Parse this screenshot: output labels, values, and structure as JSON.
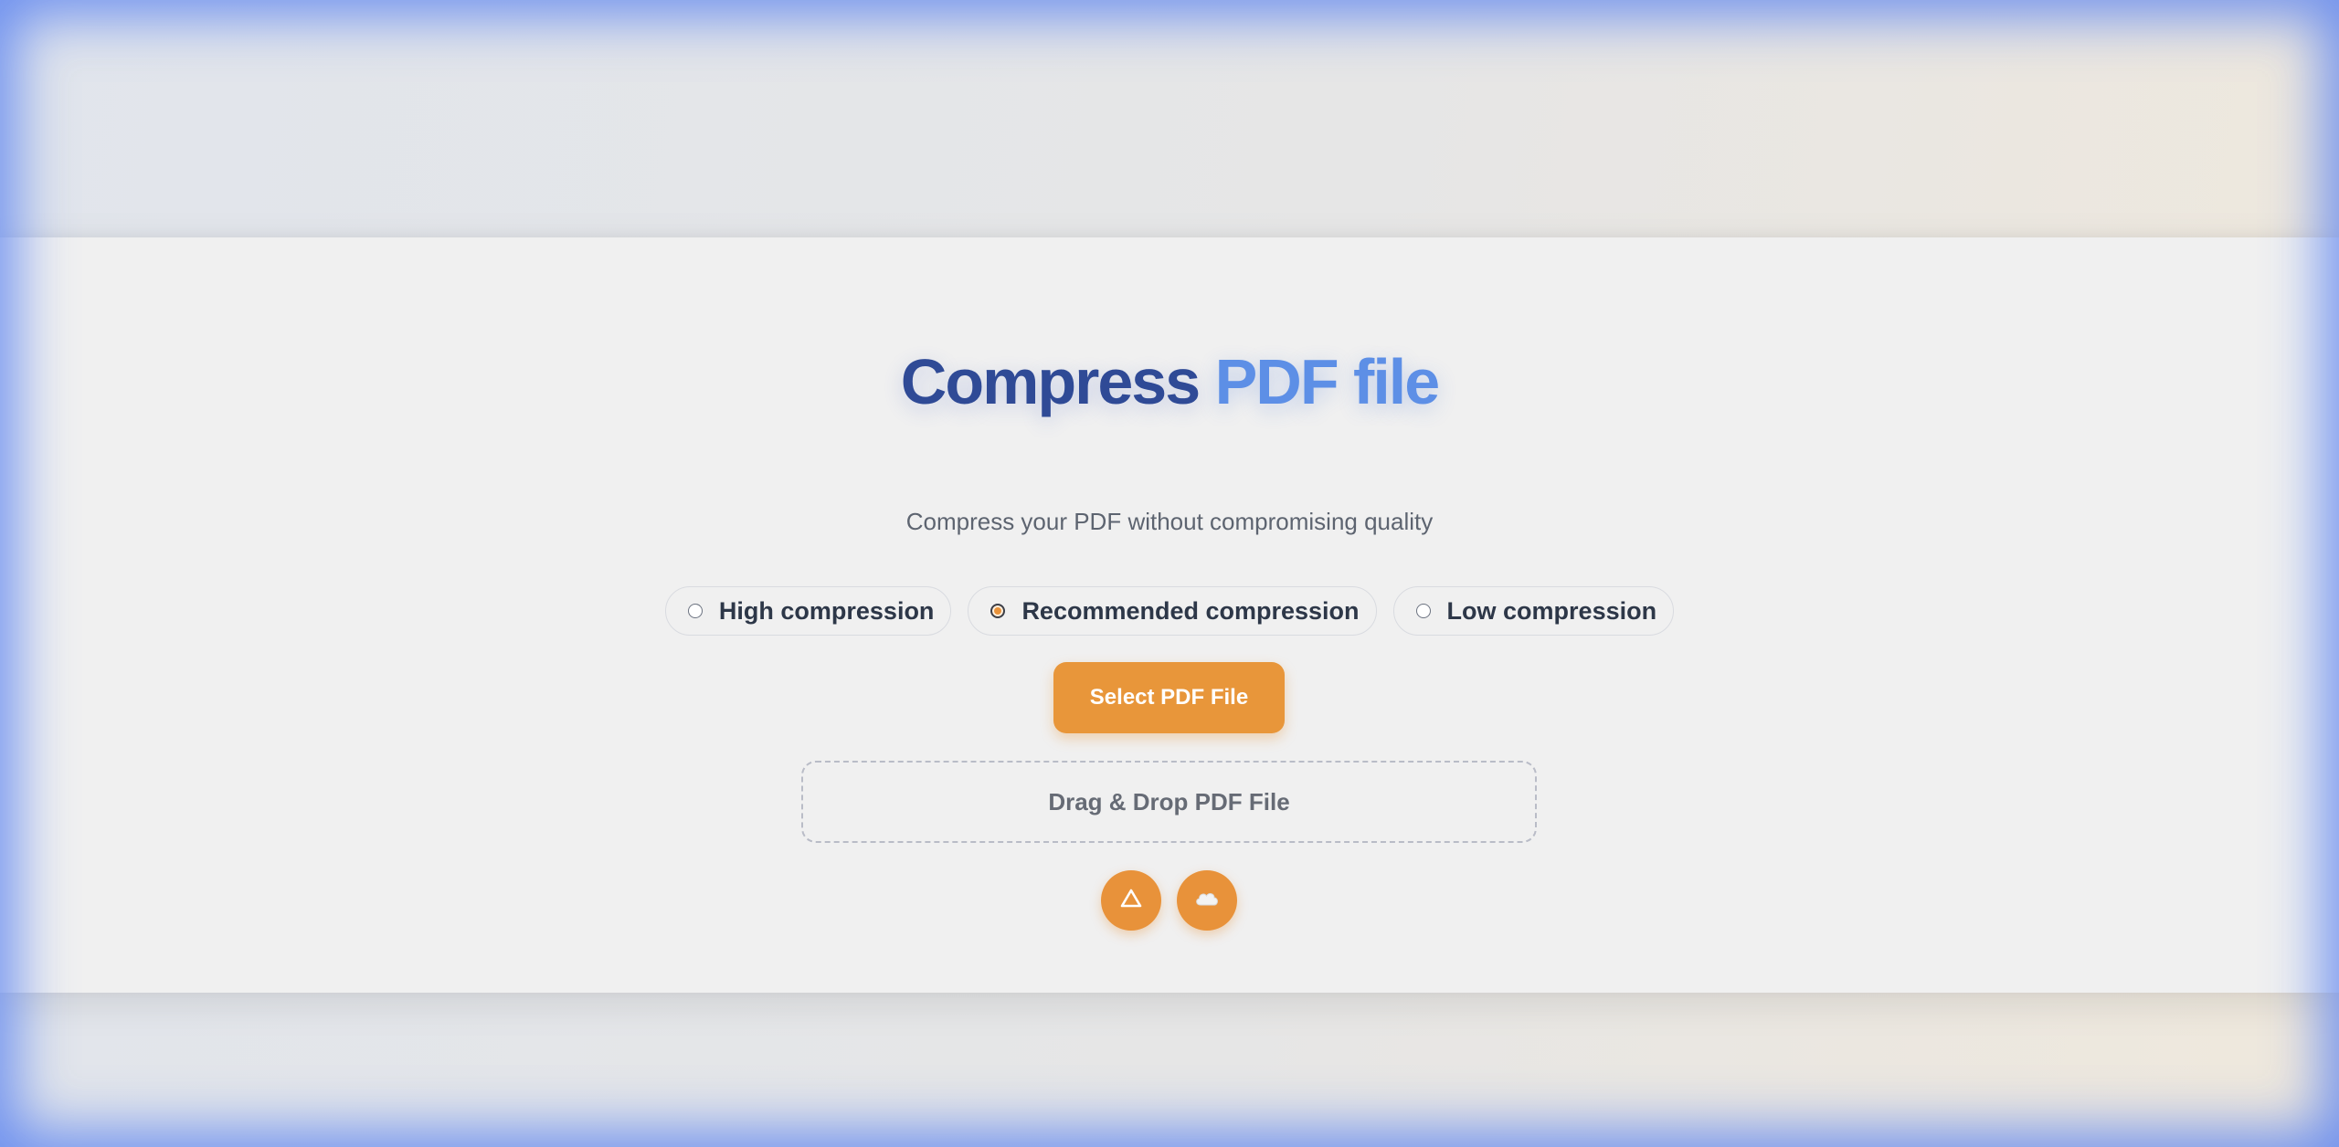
{
  "page": {
    "title_part1": "Compress",
    "title_part2": "PDF file",
    "subtitle": "Compress your PDF without compromising quality"
  },
  "compression_options": [
    {
      "label": "High compression",
      "selected": false
    },
    {
      "label": "Recommended compression",
      "selected": true
    },
    {
      "label": "Low compression",
      "selected": false
    }
  ],
  "actions": {
    "select_file_label": "Select PDF File",
    "dropzone_label": "Drag & Drop PDF File",
    "google_drive_icon": "google-drive-icon",
    "cloud_icon": "cloud-icon"
  },
  "colors": {
    "accent": "#e8963a",
    "title_dark": "#2f4a96",
    "title_light": "#5d8fe6",
    "frame_glow": "#5a82f0"
  }
}
